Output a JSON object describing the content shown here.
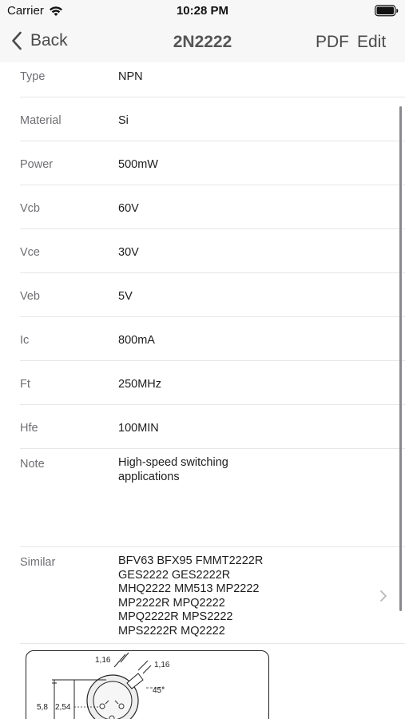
{
  "status_bar": {
    "carrier": "Carrier",
    "time": "10:28 PM"
  },
  "nav": {
    "back_label": "Back",
    "title": "2N2222",
    "pdf_label": "PDF",
    "edit_label": "Edit"
  },
  "rows": [
    {
      "label": "Type",
      "value": "NPN"
    },
    {
      "label": "Material",
      "value": "Si"
    },
    {
      "label": "Power",
      "value": "500mW"
    },
    {
      "label": "Vcb",
      "value": "60V"
    },
    {
      "label": "Vce",
      "value": "30V"
    },
    {
      "label": "Veb",
      "value": "5V"
    },
    {
      "label": "Ic",
      "value": "800mA"
    },
    {
      "label": "Ft",
      "value": "250MHz"
    },
    {
      "label": "Hfe",
      "value": "100MIN"
    }
  ],
  "note": {
    "label": "Note",
    "lines": [
      "High-speed switching",
      "applications"
    ]
  },
  "similar": {
    "label": "Similar",
    "lines": [
      "BFV63 BFX95 FMMT2222R",
      "GES2222 GES2222R",
      "MHQ2222 MM513 MP2222",
      "MP2222R MPQ2222",
      "MPQ2222R MPS2222",
      "MPS2222R MQ2222"
    ]
  },
  "package_diagram": {
    "dim_top_left": "1,16",
    "dim_top_right": "1,16",
    "angle": "45°",
    "dim_side": "5,8",
    "dim_pitch": "2,54"
  }
}
